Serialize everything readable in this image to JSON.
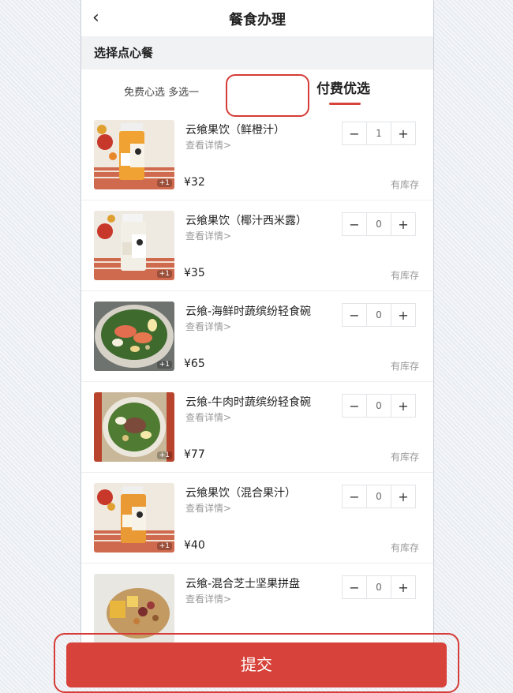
{
  "header": {
    "title": "餐食办理",
    "back_icon": "chevron-left-icon"
  },
  "section": {
    "title": "选择点心餐"
  },
  "tabs": [
    {
      "label": "免费心选 多选一",
      "active": false
    },
    {
      "label": "付费优选",
      "active": true
    }
  ],
  "accent_color": "#d7433a",
  "items": [
    {
      "name": "云飨果饮（鲜橙汁）",
      "details": "查看详情>",
      "price": "¥32",
      "stock": "有库存",
      "qty": "1",
      "badge": "+1"
    },
    {
      "name": "云飨果饮（椰汁西米露）",
      "details": "查看详情>",
      "price": "¥35",
      "stock": "有库存",
      "qty": "0",
      "badge": "+1"
    },
    {
      "name": "云飨-海鲜时蔬缤纷轻食碗",
      "details": "查看详情>",
      "price": "¥65",
      "stock": "有库存",
      "qty": "0",
      "badge": "+1"
    },
    {
      "name": "云飨-牛肉时蔬缤纷轻食碗",
      "details": "查看详情>",
      "price": "¥77",
      "stock": "有库存",
      "qty": "0",
      "badge": "+1"
    },
    {
      "name": "云飨果饮（混合果汁）",
      "details": "查看详情>",
      "price": "¥40",
      "stock": "有库存",
      "qty": "0",
      "badge": "+1"
    },
    {
      "name": "云飨-混合芝士坚果拼盘",
      "details": "查看详情>",
      "price": "",
      "stock": "",
      "qty": "0",
      "badge": ""
    }
  ],
  "stepper": {
    "minus": "−",
    "plus": "+"
  },
  "submit": {
    "label": "提交"
  }
}
